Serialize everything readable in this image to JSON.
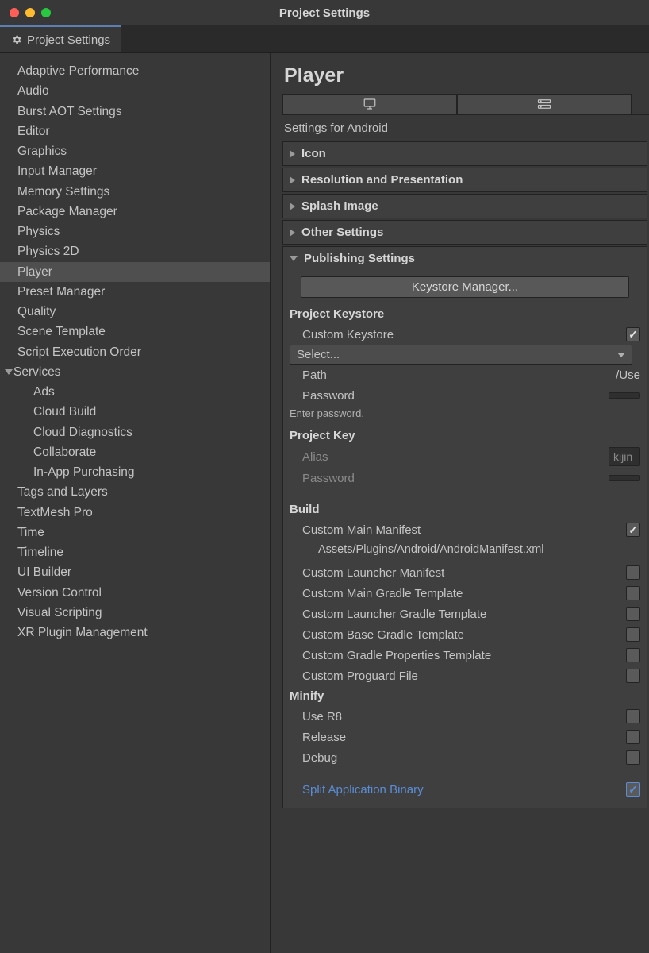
{
  "window": {
    "title": "Project Settings"
  },
  "tab": {
    "label": "Project Settings"
  },
  "sidebar": {
    "items": [
      {
        "label": "Adaptive Performance",
        "selected": false
      },
      {
        "label": "Audio",
        "selected": false
      },
      {
        "label": "Burst AOT Settings",
        "selected": false
      },
      {
        "label": "Editor",
        "selected": false
      },
      {
        "label": "Graphics",
        "selected": false
      },
      {
        "label": "Input Manager",
        "selected": false
      },
      {
        "label": "Memory Settings",
        "selected": false
      },
      {
        "label": "Package Manager",
        "selected": false
      },
      {
        "label": "Physics",
        "selected": false
      },
      {
        "label": "Physics 2D",
        "selected": false
      },
      {
        "label": "Player",
        "selected": true
      },
      {
        "label": "Preset Manager",
        "selected": false
      },
      {
        "label": "Quality",
        "selected": false
      },
      {
        "label": "Scene Template",
        "selected": false
      },
      {
        "label": "Script Execution Order",
        "selected": false
      }
    ],
    "services": {
      "label": "Services",
      "children": [
        {
          "label": "Ads"
        },
        {
          "label": "Cloud Build"
        },
        {
          "label": "Cloud Diagnostics"
        },
        {
          "label": "Collaborate"
        },
        {
          "label": "In-App Purchasing"
        }
      ]
    },
    "items2": [
      {
        "label": "Tags and Layers"
      },
      {
        "label": "TextMesh Pro"
      },
      {
        "label": "Time"
      },
      {
        "label": "Timeline"
      },
      {
        "label": "UI Builder"
      },
      {
        "label": "Version Control"
      },
      {
        "label": "Visual Scripting"
      },
      {
        "label": "XR Plugin Management"
      }
    ]
  },
  "main": {
    "title": "Player",
    "settings_for": "Settings for Android",
    "sections": [
      {
        "label": "Icon",
        "expanded": false
      },
      {
        "label": "Resolution and Presentation",
        "expanded": false
      },
      {
        "label": "Splash Image",
        "expanded": false
      },
      {
        "label": "Other Settings",
        "expanded": false
      }
    ],
    "publishing": {
      "label": "Publishing Settings",
      "keystore_manager_btn": "Keystore Manager...",
      "project_keystore": {
        "label": "Project Keystore",
        "custom_keystore_label": "Custom Keystore",
        "custom_keystore_checked": true,
        "select_label": "Select...",
        "path_label": "Path",
        "path_value": "/Use",
        "password_label": "Password",
        "enter_password": "Enter password."
      },
      "project_key": {
        "label": "Project Key",
        "alias_label": "Alias",
        "alias_value": "kijin",
        "password_label": "Password"
      },
      "build": {
        "label": "Build",
        "rows": [
          {
            "label": "Custom Main Manifest",
            "checked": true,
            "path": "Assets/Plugins/Android/AndroidManifest.xml"
          },
          {
            "label": "Custom Launcher Manifest",
            "checked": false
          },
          {
            "label": "Custom Main Gradle Template",
            "checked": false
          },
          {
            "label": "Custom Launcher Gradle Template",
            "checked": false
          },
          {
            "label": "Custom Base Gradle Template",
            "checked": false
          },
          {
            "label": "Custom Gradle Properties Template",
            "checked": false
          },
          {
            "label": "Custom Proguard File",
            "checked": false
          }
        ]
      },
      "minify": {
        "label": "Minify",
        "rows": [
          {
            "label": "Use R8",
            "checked": false
          },
          {
            "label": "Release",
            "checked": false
          },
          {
            "label": "Debug",
            "checked": false
          }
        ]
      },
      "split_binary": {
        "label": "Split Application Binary",
        "checked": true
      }
    }
  }
}
